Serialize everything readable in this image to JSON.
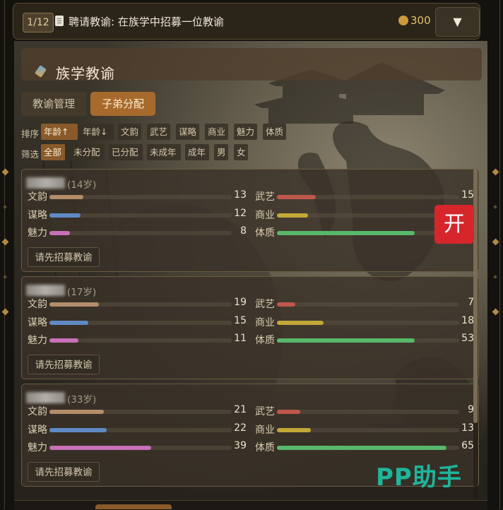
{
  "task": {
    "counter": "1/12",
    "text": "聘请教谕: 在族学中招募一位教谕",
    "coins": "300",
    "dropdown_symbol": "▼"
  },
  "panel": {
    "title": "族学教谕",
    "tabs": [
      {
        "label": "教谕管理",
        "active": false
      },
      {
        "label": "子弟分配",
        "active": true
      }
    ],
    "sort": {
      "label": "排序",
      "options": [
        "年龄↑",
        "年龄↓",
        "文韵",
        "武艺",
        "谋略",
        "商业",
        "魅力",
        "体质"
      ],
      "active": "年龄↑"
    },
    "filter": {
      "label": "筛选",
      "options": [
        "全部",
        "未分配",
        "已分配",
        "未成年",
        "成年",
        "男",
        "女"
      ],
      "active": "全部"
    }
  },
  "stat_max": 70,
  "students": [
    {
      "age": "(14岁)",
      "stats": {
        "文韵": 13,
        "武艺": 15,
        "谋略": 12,
        "商业": 12,
        "魅力": 8,
        "体质": 53
      },
      "visible_values": [
        "13",
        "15",
        "12",
        "",
        "8",
        ""
      ],
      "button": "请先招募教谕"
    },
    {
      "age": "(17岁)",
      "stats": {
        "文韵": 19,
        "武艺": 7,
        "谋略": 15,
        "商业": 18,
        "魅力": 11,
        "体质": 53
      },
      "visible_values": [
        "19",
        "7",
        "15",
        "18",
        "11",
        "53"
      ],
      "button": "请先招募教谕"
    },
    {
      "age": "(33岁)",
      "stats": {
        "文韵": 21,
        "武艺": 9,
        "谋略": 22,
        "商业": 13,
        "魅力": 39,
        "体质": 65
      },
      "visible_values": [
        "21",
        "9",
        "22",
        "13",
        "39",
        "65"
      ],
      "button": "请先招募教谕"
    }
  ],
  "stat_colors": {
    "文韵": "#b38d6a",
    "武艺": "#c0574c",
    "谋略": "#5f8ac4",
    "商业": "#c2a838",
    "魅力": "#c870b8",
    "体质": "#58b86a"
  },
  "overlay": {
    "open_badge": "开",
    "watermark": "PP助手"
  }
}
